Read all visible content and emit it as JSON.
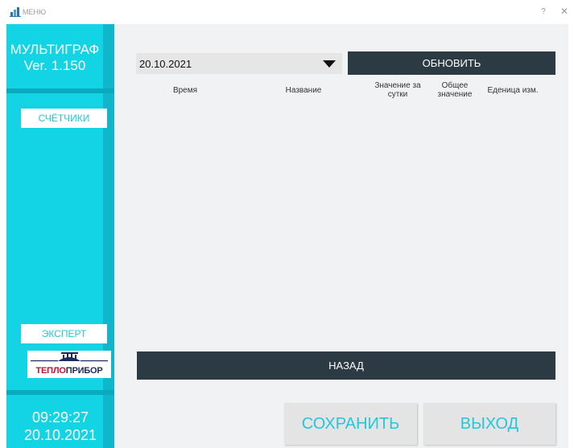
{
  "window": {
    "title": "МЕНЮ",
    "help_glyph": "?",
    "close_glyph": "✕"
  },
  "sidebar": {
    "brand_name": "МУЛЬТИГРАФ",
    "brand_version": "Ver. 1.150",
    "counters_label": "СЧЁТЧИКИ",
    "expert_label": "ЭКСПЕРТ",
    "logo_word_part1": "ТЕПЛО",
    "logo_word_part2": "ПРИБОР",
    "time": "09:29:27",
    "date": "20.10.2021"
  },
  "main": {
    "date_select_value": "20.10.2021",
    "refresh_label": "ОБНОВИТЬ",
    "columns": [
      "Время",
      "Название",
      "Значение за сутки",
      "Общее значение",
      "Еденица изм."
    ],
    "rows": [],
    "back_label": "НАЗАД",
    "save_label": "СОХРАНИТЬ",
    "exit_label": "ВЫХОД"
  },
  "colors": {
    "accent": "#20c8dc",
    "dark_button": "#2c3a44",
    "content_bg": "#f1f2f4"
  },
  "icons": {
    "app": "bar-chart-icon",
    "dropdown": "triangle-down-icon"
  }
}
